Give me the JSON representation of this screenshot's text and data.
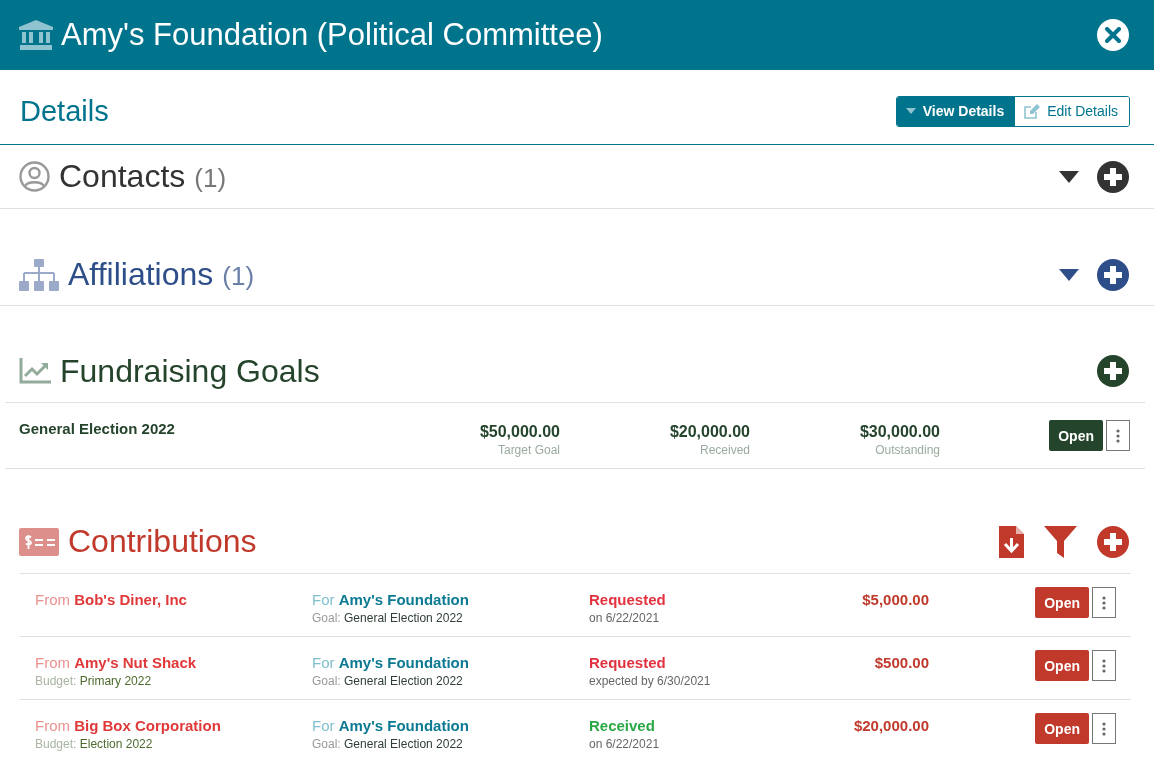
{
  "window": {
    "title": "Amy's Foundation (Political Committee)"
  },
  "details": {
    "title": "Details",
    "modes": [
      {
        "label": "View Details",
        "kind": "view",
        "selected": true
      },
      {
        "label": "Edit Details",
        "kind": "edit",
        "selected": false
      }
    ]
  },
  "contacts": {
    "title": "Contacts",
    "count": "(1)"
  },
  "affiliations": {
    "title": "Affiliations",
    "count": "(1)"
  },
  "fundraising_goals": {
    "title": "Fundraising Goals",
    "rows": [
      {
        "name": "General Election 2022",
        "target": "$50,000.00",
        "target_label": "Target Goal",
        "received": "$20,000.00",
        "received_label": "Received",
        "outstanding": "$30,000.00",
        "outstanding_label": "Outstanding",
        "button": "Open"
      }
    ]
  },
  "contributions": {
    "title": "Contributions",
    "rows": [
      {
        "from_label": "From",
        "from": "Bob's Diner, Inc",
        "for_label": "For",
        "for": "Amy's Foundation",
        "goal_label": "Goal:",
        "goal": "General Election 2022",
        "status": "Requested",
        "kind": "requested",
        "date": "on 6/22/2021",
        "amount": "$5,000.00",
        "button": "Open"
      },
      {
        "from_label": "From",
        "from": "Amy's Nut Shack",
        "budget_label": "Budget:",
        "budget": "Primary 2022",
        "for_label": "For",
        "for": "Amy's Foundation",
        "goal_label": "Goal:",
        "goal": "General Election 2022",
        "status": "Requested",
        "kind": "requested",
        "date": "expected by 6/30/2021",
        "amount": "$500.00",
        "button": "Open"
      },
      {
        "from_label": "From",
        "from": "Big Box Corporation",
        "budget_label": "Budget:",
        "budget": "Election 2022",
        "for_label": "For",
        "for": "Amy's Foundation",
        "goal_label": "Goal:",
        "goal": "General Election 2022",
        "status": "Received",
        "kind": "received",
        "date": "on 6/22/2021",
        "amount": "$20,000.00",
        "button": "Open"
      }
    ]
  }
}
